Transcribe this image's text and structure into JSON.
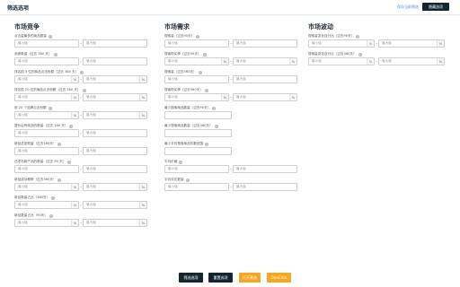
{
  "header": {
    "title": "筛选选项",
    "save_link": "保存当前筛选",
    "hide_button": "隐藏选项"
  },
  "placeholders": {
    "min": "最小值",
    "max": "最大值"
  },
  "units": {
    "percent": "%"
  },
  "columns": [
    {
      "title": "市场竞争",
      "fields": [
        {
          "label": "点击量最多的商品数量"
        },
        {
          "label": "卖家数量（过去 360 天）"
        },
        {
          "label": "排名前 3 位的商品点击份额（过去 360 天）",
          "suffix": "%"
        },
        {
          "label": "排名前 20 位的商品点击份额（过去 360 天）",
          "suffix": "%"
        },
        {
          "label": "前 20 个品牌点击份额",
          "suffix": "%"
        },
        {
          "label": "提价后有商品的数量（过去 180 天）"
        },
        {
          "label": "新品总加购量（过去180天）"
        },
        {
          "label": "已发布新产品的数量（过去 90 天）"
        },
        {
          "label": "新品成功概率（过去360天）",
          "suffix": "%"
        },
        {
          "label": "新品数量占比（360天）",
          "suffix": "%"
        },
        {
          "label": "新品数量占比（90天）",
          "suffix": "%"
        }
      ]
    },
    {
      "title": "市场需求",
      "fields": [
        {
          "label": "搜索量（过去90天）",
          "type": "range"
        },
        {
          "label": "搜索购买率（过去90天）",
          "type": "range",
          "suffix": "%"
        },
        {
          "label": "搜索量（过去360天）",
          "type": "range"
        },
        {
          "label": "搜索购买率（过去360天）",
          "type": "range",
          "suffix": "%"
        },
        {
          "label": "最少搜索商品数量（过去90天）",
          "type": "single"
        },
        {
          "label": "最少搜索商品数量（过去360天）",
          "type": "single"
        },
        {
          "label": "最少平均搜索商品件数范围",
          "type": "single"
        },
        {
          "label": "平均价格",
          "type": "range"
        },
        {
          "label": "平均评论数量",
          "type": "range"
        }
      ]
    },
    {
      "title": "市场波动",
      "fields": [
        {
          "label": "搜索量变化百分比（过去90天）",
          "suffix": "%"
        },
        {
          "label": "搜索量变化百分比（过去360天）",
          "suffix": "%"
        }
      ]
    }
  ],
  "footer": {
    "apply": "筛选选项",
    "reset": "重置选项",
    "open": "打开筛选",
    "oneclick": "OneClick"
  },
  "colors": {
    "primary_dark": "#13262f",
    "accent_orange": "#f5a623",
    "link_blue": "#4a90d9"
  }
}
